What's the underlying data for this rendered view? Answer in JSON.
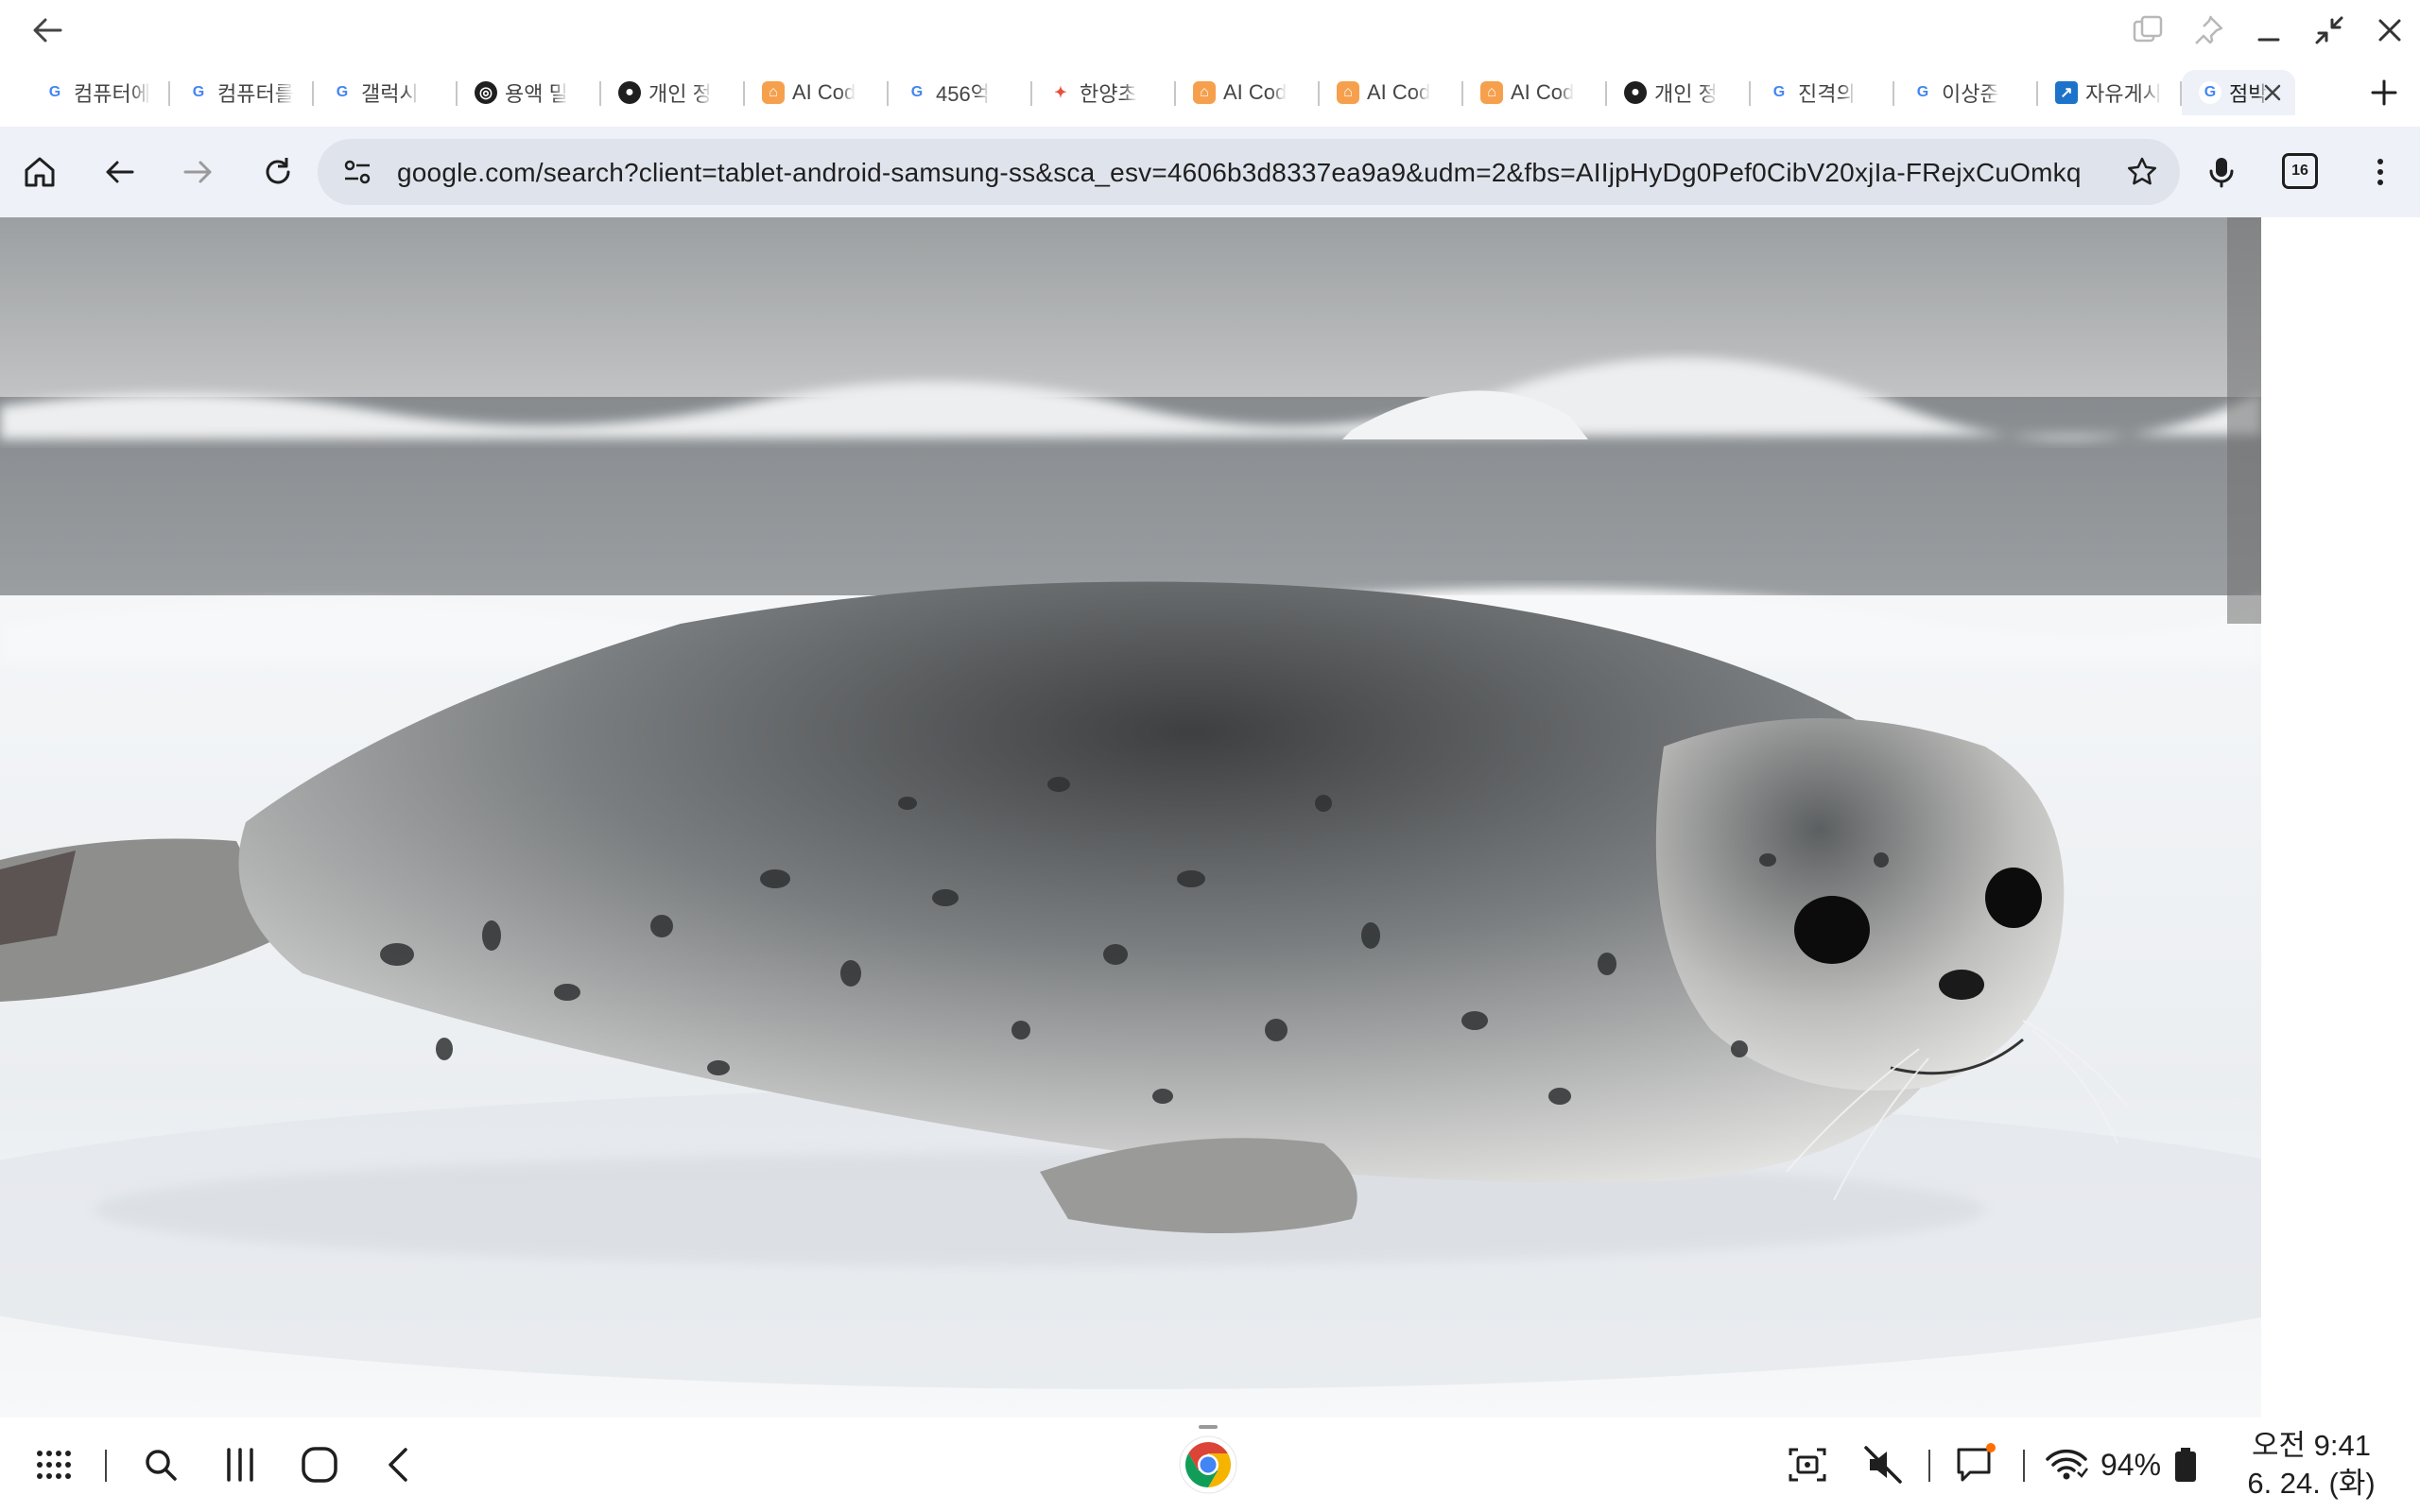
{
  "browser": {
    "tabs": [
      {
        "title": "컴퓨터에",
        "favicon": "google-g-icon"
      },
      {
        "title": "컴퓨터를",
        "favicon": "google-g-icon"
      },
      {
        "title": "갤럭시",
        "favicon": "google-g-icon"
      },
      {
        "title": "용액 밀",
        "favicon": "openai-icon"
      },
      {
        "title": "개인 정",
        "favicon": "globe-icon"
      },
      {
        "title": "AI Cod",
        "favicon": "robot-icon"
      },
      {
        "title": "456억",
        "favicon": "google-g-icon"
      },
      {
        "title": "한양초",
        "favicon": "colorful-star-icon"
      },
      {
        "title": "AI Cod",
        "favicon": "robot-icon"
      },
      {
        "title": "AI Cod",
        "favicon": "robot-icon"
      },
      {
        "title": "AI Cod",
        "favicon": "robot-icon"
      },
      {
        "title": "개인 정",
        "favicon": "globe-icon"
      },
      {
        "title": "진격의",
        "favicon": "google-g-icon"
      },
      {
        "title": "이상준",
        "favicon": "google-g-icon"
      },
      {
        "title": "자유게시",
        "favicon": "blue-square-icon"
      },
      {
        "title": "점박이",
        "favicon": "google-g-icon",
        "active": true
      }
    ],
    "url": "google.com/search?client=tablet-android-samsung-ss&sca_esv=4606b3d8337ea9a9&udm=2&fbs=AIIjpHyDg0Pef0CibV20xjIa-FRejxCuOmkq",
    "tab_count": "16"
  },
  "content": {
    "image_subject": "spotted seal lying on ice"
  },
  "status": {
    "battery": "94%",
    "time": "오전 9:41",
    "date": "6. 24. (화)"
  },
  "colors": {
    "toolbar_bg": "#eef1f8",
    "omnibox_bg": "#dfe3eb",
    "accent_orange": "#ff6d00"
  }
}
